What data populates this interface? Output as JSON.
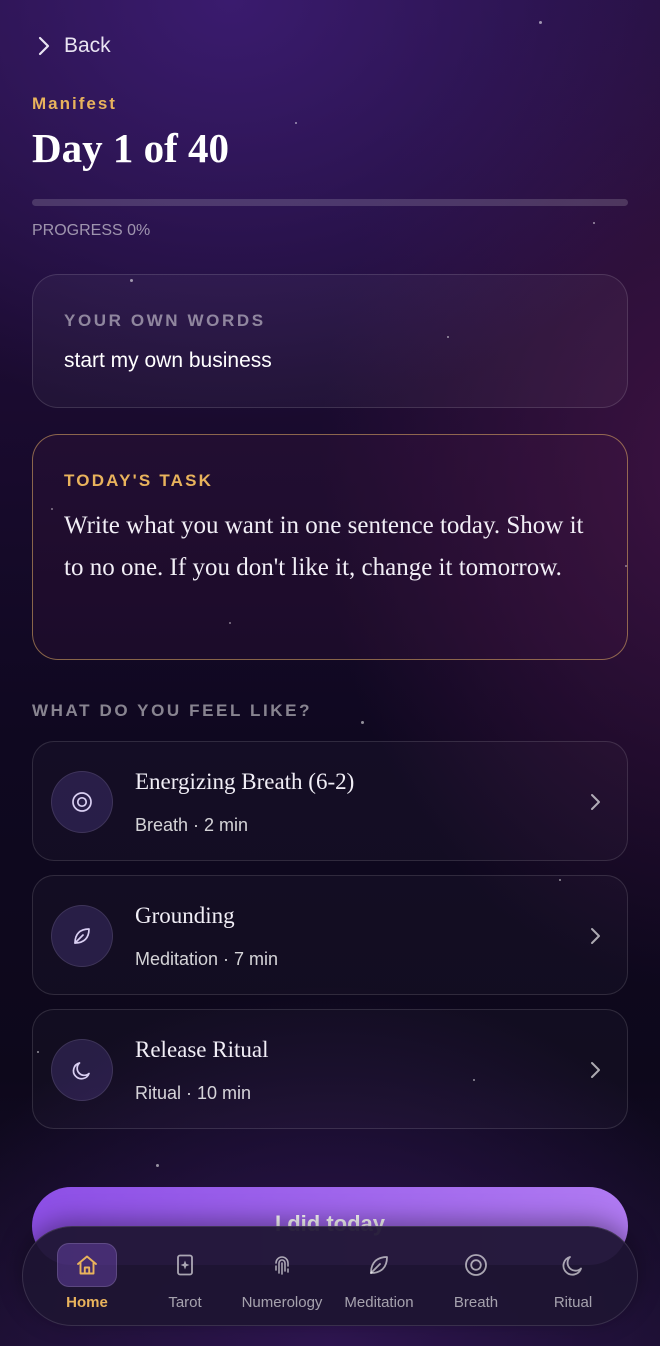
{
  "nav": {
    "back_label": "Back"
  },
  "header": {
    "eyebrow": "Manifest",
    "title": "Day 1 of 40"
  },
  "progress": {
    "value_percent": 0,
    "label": "PROGRESS 0%"
  },
  "own_words": {
    "caption": "YOUR OWN WORDS",
    "value": "start my own business"
  },
  "task": {
    "caption": "TODAY'S TASK",
    "body": "Write what you want in one sentence today. Show it to no one. If you don't like it, change it tomorrow."
  },
  "feel": {
    "caption": "WHAT DO YOU FEEL LIKE?",
    "items": [
      {
        "title": "Energizing Breath (6-2)",
        "meta": "Breath · 2 min",
        "icon": "breath-icon"
      },
      {
        "title": "Grounding",
        "meta": "Meditation · 7 min",
        "icon": "leaf-icon"
      },
      {
        "title": "Release Ritual",
        "meta": "Ritual · 10 min",
        "icon": "moon-icon"
      }
    ]
  },
  "cta": {
    "label": "I did today"
  },
  "tabbar": {
    "active": "Home",
    "items": [
      {
        "label": "Home",
        "icon": "home-icon"
      },
      {
        "label": "Tarot",
        "icon": "tarot-card-icon"
      },
      {
        "label": "Numerology",
        "icon": "fingerprint-icon"
      },
      {
        "label": "Meditation",
        "icon": "leaf-icon"
      },
      {
        "label": "Breath",
        "icon": "breath-icon"
      },
      {
        "label": "Ritual",
        "icon": "moon-icon"
      }
    ]
  },
  "colors": {
    "accent_gold": "#e9b35c",
    "cta_purple": "#8d4fe6",
    "background": "#1a0b2f"
  }
}
